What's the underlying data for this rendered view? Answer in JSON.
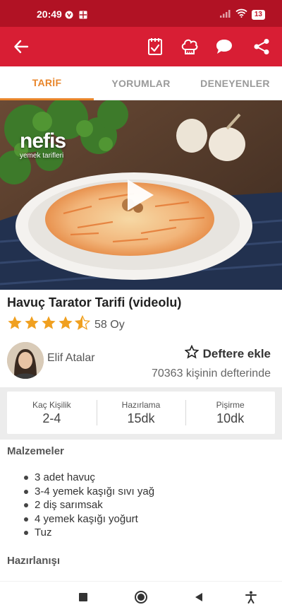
{
  "status_bar": {
    "time": "20:49",
    "battery": "13"
  },
  "app_bar": {
    "icons": [
      "back-arrow-icon",
      "notebook-check-icon",
      "chef-hat-icon",
      "comment-icon",
      "share-icon"
    ],
    "background_color": "#d81e34"
  },
  "tabs": [
    {
      "label": "TARİF",
      "active": true
    },
    {
      "label": "YORUMLAR",
      "active": false
    },
    {
      "label": "DENEYENLER",
      "active": false
    }
  ],
  "hero": {
    "brand": "nefis",
    "brand_subtitle": "yemek tarifleri"
  },
  "recipe": {
    "title": "Havuç Tarator Tarifi (videolu)",
    "rating": 4.5,
    "votes": "58 Oy"
  },
  "author": {
    "name": "Elif Atalar",
    "add_to_notebook": "Deftere ekle",
    "notebook_count": "70363 kişinin defterinde"
  },
  "stats": [
    {
      "label": "Kaç Kişilik",
      "value": "2-4"
    },
    {
      "label": "Hazırlama",
      "value": "15dk"
    },
    {
      "label": "Pişirme",
      "value": "10dk"
    }
  ],
  "ingredients": {
    "title": "Malzemeler",
    "items": [
      "3 adet havuç",
      "3-4 yemek kaşığı sıvı yağ",
      "2 diş sarımsak",
      "4 yemek kaşığı yoğurt",
      "Tuz"
    ]
  },
  "preparation": {
    "title": "Hazırlanışı"
  },
  "colors": {
    "accent": "#e8852a",
    "brand_red": "#d81e34",
    "star": "#f0a020"
  }
}
